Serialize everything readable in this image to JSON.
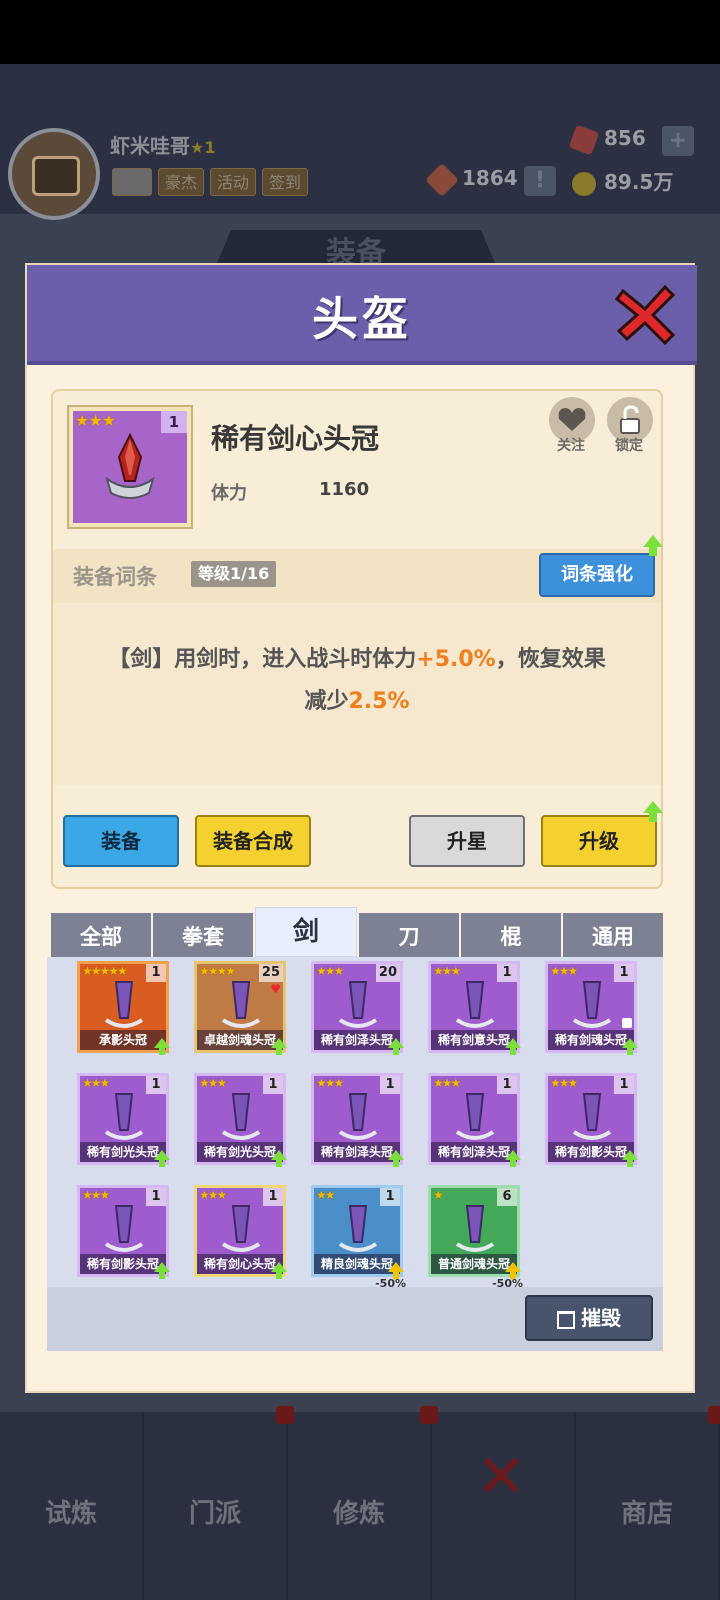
{
  "player": {
    "name": "虾米哇哥",
    "level": "1"
  },
  "header_buttons": [
    "豪杰",
    "活动",
    "签到"
  ],
  "resources": {
    "gems": "856",
    "tokens": "1864",
    "gold": "89.5万"
  },
  "background_section_title": "装备",
  "modal": {
    "title": "头盔",
    "item": {
      "name": "稀有剑心头冠",
      "stars": 3,
      "count": "1",
      "stat_label": "体力",
      "stat_value": "1160",
      "follow_label": "关注",
      "lock_label": "锁定"
    },
    "affix": {
      "title": "装备词条",
      "level": "等级1/16",
      "button": "词条强化",
      "desc_line1_prefix": "【剑】用剑时，进入战斗时体力",
      "desc_line1_highlight": "+5.0%",
      "desc_line1_suffix": "，恢复效果",
      "desc_line2_prefix": "减少",
      "desc_line2_highlight": "2.5%"
    },
    "buttons": {
      "equip": "装备",
      "compose": "装备合成",
      "star_up": "升星",
      "upgrade": "升级",
      "destroy": "摧毁"
    },
    "tabs": [
      "全部",
      "拳套",
      "剑",
      "刀",
      "棍",
      "通用"
    ],
    "active_tab": "剑",
    "items": [
      {
        "name": "承影头冠",
        "stars": "★★★★★",
        "count": "1",
        "color": "orange"
      },
      {
        "name": "卓越剑魂头冠",
        "stars": "★★★★",
        "count": "25",
        "color": "brown"
      },
      {
        "name": "稀有剑泽头冠",
        "stars": "★★★",
        "count": "20",
        "color": "purple"
      },
      {
        "name": "稀有剑意头冠",
        "stars": "★★★",
        "count": "1",
        "color": "purple"
      },
      {
        "name": "稀有剑魂头冠",
        "stars": "★★★",
        "count": "1",
        "color": "purple"
      },
      {
        "name": "稀有剑光头冠",
        "stars": "★★★",
        "count": "1",
        "color": "purple"
      },
      {
        "name": "稀有剑光头冠",
        "stars": "★★★",
        "count": "1",
        "color": "purple"
      },
      {
        "name": "稀有剑泽头冠",
        "stars": "★★★",
        "count": "1",
        "color": "purple"
      },
      {
        "name": "稀有剑泽头冠",
        "stars": "★★★",
        "count": "1",
        "color": "purple"
      },
      {
        "name": "稀有剑影头冠",
        "stars": "★★★",
        "count": "1",
        "color": "purple"
      },
      {
        "name": "稀有剑影头冠",
        "stars": "★★★",
        "count": "1",
        "color": "purple"
      },
      {
        "name": "稀有剑心头冠",
        "stars": "★★★",
        "count": "1",
        "color": "purple"
      },
      {
        "name": "精良剑魂头冠",
        "stars": "★★",
        "count": "1",
        "color": "blue",
        "discount": "-50%"
      },
      {
        "name": "普通剑魂头冠",
        "stars": "★",
        "count": "6",
        "color": "green",
        "discount": "-50%"
      }
    ]
  },
  "nav": [
    "试炼",
    "门派",
    "修炼",
    "",
    "商店"
  ],
  "colors": {
    "modal_header": "#6b5fab",
    "highlight": "#f07f1c",
    "upgrade_arrow": "#7be03c"
  }
}
